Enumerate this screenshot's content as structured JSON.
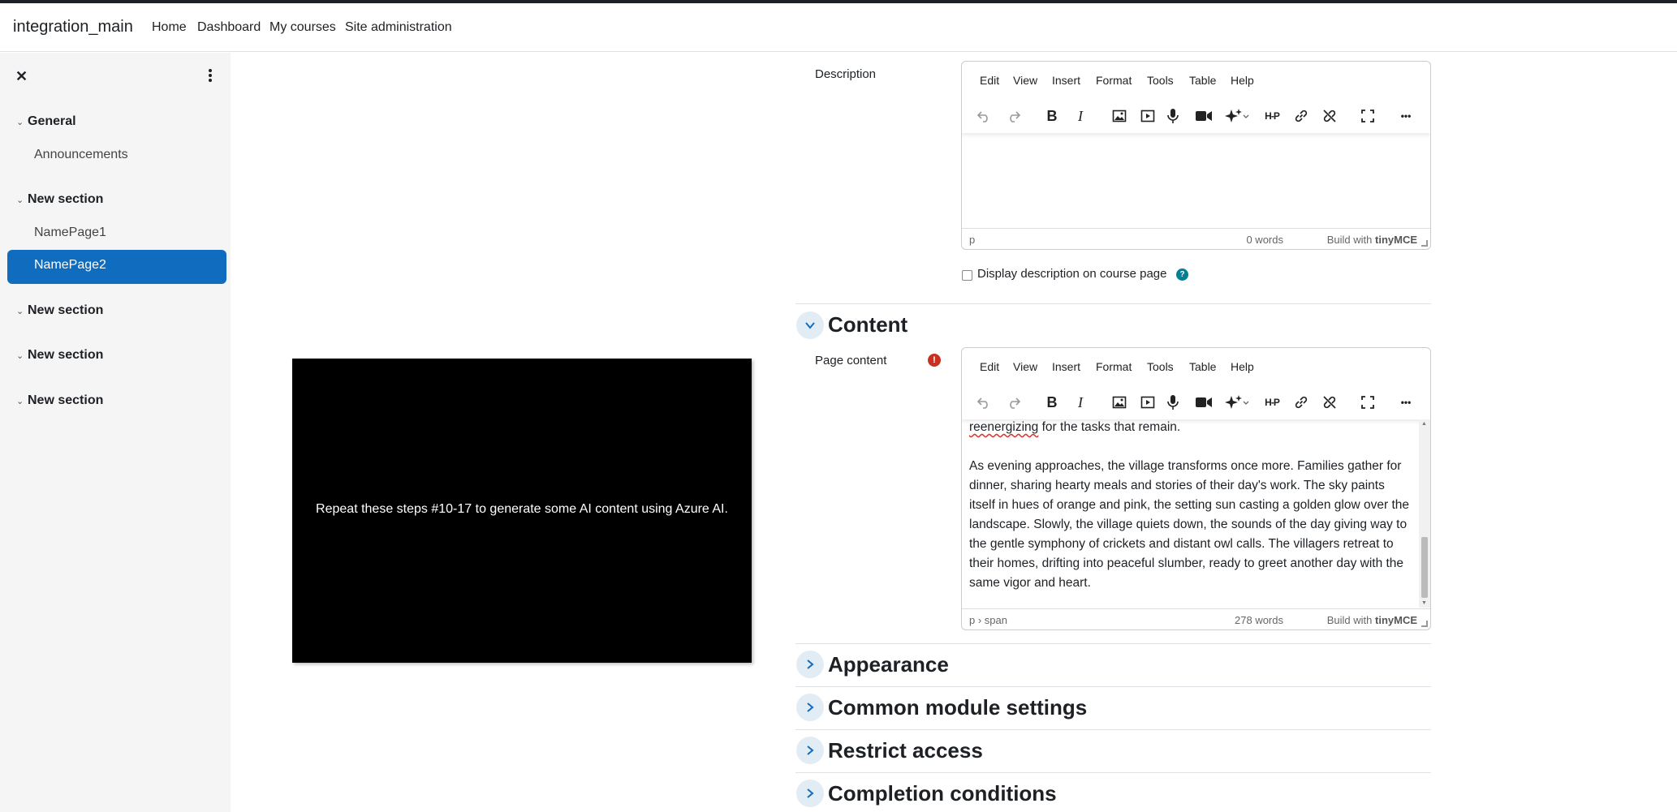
{
  "navbar": {
    "site_name": "integration_main",
    "links": [
      "Home",
      "Dashboard",
      "My courses",
      "Site administration"
    ]
  },
  "drawer": {
    "sections": [
      {
        "title": "General",
        "items": [
          "Announcements"
        ]
      },
      {
        "title": "New section",
        "items": [
          "NamePage1",
          "NamePage2"
        ]
      },
      {
        "title": "New section",
        "items": []
      },
      {
        "title": "New section",
        "items": []
      },
      {
        "title": "New section",
        "items": []
      }
    ],
    "active_item": "NamePage2"
  },
  "video": {
    "caption": "Repeat these steps #10-17 to generate some AI content using Azure AI."
  },
  "editor_menu": [
    "Edit",
    "View",
    "Insert",
    "Format",
    "Tools",
    "Table",
    "Help"
  ],
  "toolbar_icons": [
    "undo-icon",
    "redo-icon",
    "bold-icon",
    "italic-icon",
    "image-icon",
    "media-icon",
    "microphone-icon",
    "video-camera-icon",
    "ai-sparkle-icon",
    "h5p-icon",
    "link-icon",
    "unlink-icon",
    "fullscreen-icon",
    "more-icon"
  ],
  "toolbar": {
    "bold": "B",
    "italic": "I",
    "h5p": "H-P",
    "more": "•••"
  },
  "description": {
    "label": "Description",
    "status_path": "p",
    "word_count": "0 words",
    "build_with": "Build with",
    "brand": "tinyMCE",
    "checkbox_label": "Display description on course page"
  },
  "content_section": {
    "title": "Content",
    "page_content_label": "Page content",
    "text_word": "reenergizing",
    "text_first": " for the tasks that remain.",
    "text_second": "As evening approaches, the village transforms once more. Families gather for dinner, sharing hearty meals and stories of their day's work. The sky paints itself in hues of orange and pink, the setting sun casting a golden glow over the landscape. Slowly, the village quiets down, the sounds of the day giving way to the gentle symphony of crickets and distant owl calls. The villagers retreat to their homes, drifting into peaceful slumber, ready to greet another day with the same vigor and heart.",
    "status_path": "p › span",
    "word_count": "278 words",
    "build_with": "Build with",
    "brand": "tinyMCE"
  },
  "collapsed_sections": [
    "Appearance",
    "Common module settings",
    "Restrict access",
    "Completion conditions"
  ],
  "colors": {
    "accent": "#0f6cbf",
    "error": "#ca3120",
    "help": "#008196"
  }
}
